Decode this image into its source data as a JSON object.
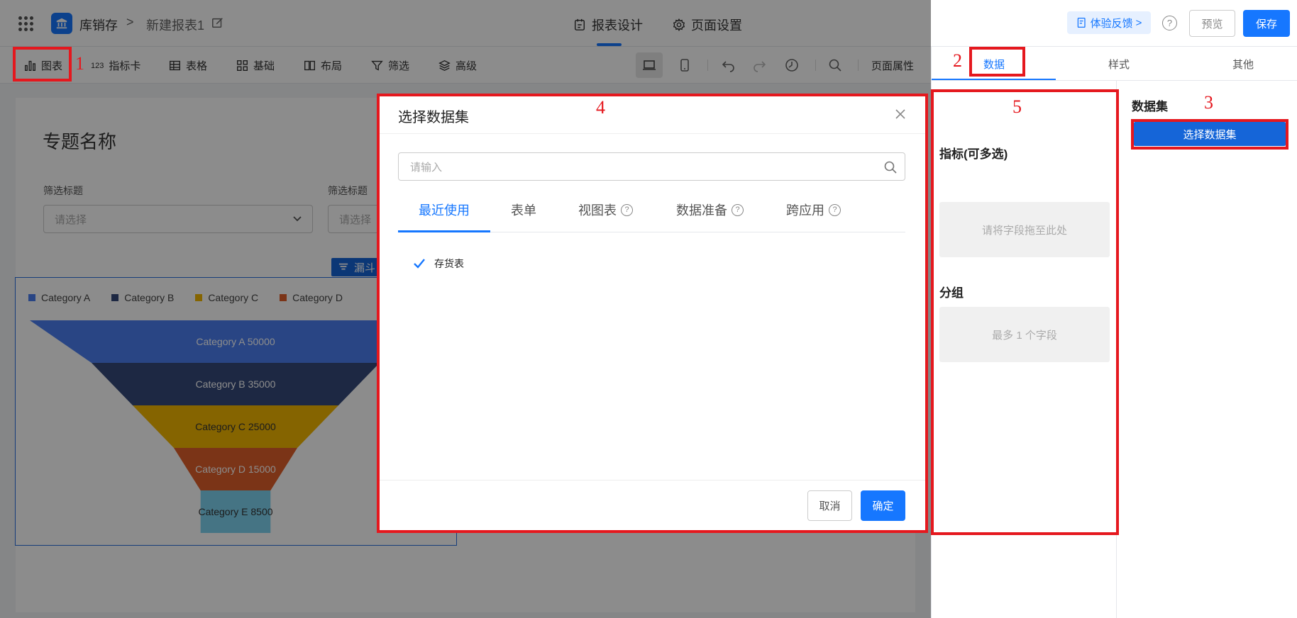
{
  "header": {
    "app_name": "库销存",
    "separator": ">",
    "report_name": "新建报表1",
    "tabs": [
      {
        "label": "报表设计",
        "icon": "calendar-icon"
      },
      {
        "label": "页面设置",
        "icon": "gear-icon"
      }
    ],
    "feedback_label": "体验反馈",
    "feedback_chevron": ">",
    "help_glyph": "?",
    "preview_label": "预览",
    "save_label": "保存"
  },
  "toolbar": {
    "items": [
      {
        "label": "图表",
        "icon": "bar-chart-icon"
      },
      {
        "label": "指标卡",
        "icon": "number-icon",
        "glyph": "123"
      },
      {
        "label": "表格",
        "icon": "table-icon"
      },
      {
        "label": "基础",
        "icon": "grid-icon"
      },
      {
        "label": "布局",
        "icon": "layout-icon"
      },
      {
        "label": "筛选",
        "icon": "filter-icon"
      },
      {
        "label": "高级",
        "icon": "layers-icon"
      }
    ],
    "page_props_label": "页面属性"
  },
  "canvas": {
    "topic_title": "专题名称",
    "filters": [
      {
        "label": "筛选标题",
        "placeholder": "请选择"
      },
      {
        "label": "筛选标题",
        "placeholder": "请选择"
      }
    ],
    "chart_tag_label": "漏斗"
  },
  "chart_data": {
    "type": "funnel",
    "categories": [
      "Category A",
      "Category B",
      "Category C",
      "Category D",
      "Category E"
    ],
    "values": [
      50000,
      35000,
      25000,
      15000,
      8500
    ],
    "labels": [
      "Category A 50000",
      "Category B 35000",
      "Category C 25000",
      "Category D 15000",
      "Category E 8500"
    ],
    "colors": [
      "#4b7ff0",
      "#364a7a",
      "#f2b600",
      "#e0602a",
      "#7fd3f0"
    ],
    "legend_position": "top-left"
  },
  "panel": {
    "tabs": [
      {
        "label": "数据",
        "active": true
      },
      {
        "label": "样式",
        "active": false
      },
      {
        "label": "其他",
        "active": false
      }
    ],
    "metrics_title": "指标(可多选)",
    "metrics_placeholder": "请将字段拖至此处",
    "group_title": "分组",
    "group_placeholder": "最多 1 个字段",
    "dataset_title": "数据集",
    "select_dataset_label": "选择数据集"
  },
  "modal": {
    "title": "选择数据集",
    "search_placeholder": "请输入",
    "tabs": [
      {
        "label": "最近使用",
        "active": true,
        "help": false
      },
      {
        "label": "表单",
        "active": false,
        "help": false
      },
      {
        "label": "视图表",
        "active": false,
        "help": true
      },
      {
        "label": "数据准备",
        "active": false,
        "help": true
      },
      {
        "label": "跨应用",
        "active": false,
        "help": true
      }
    ],
    "help_glyph": "?",
    "items": [
      {
        "label": "存货表",
        "checked": true
      }
    ],
    "cancel_label": "取消",
    "ok_label": "确定"
  },
  "annotations": [
    "1",
    "2",
    "3",
    "4",
    "5"
  ],
  "colors": {
    "accent": "#1677ff",
    "annotation": "#e5181e"
  }
}
